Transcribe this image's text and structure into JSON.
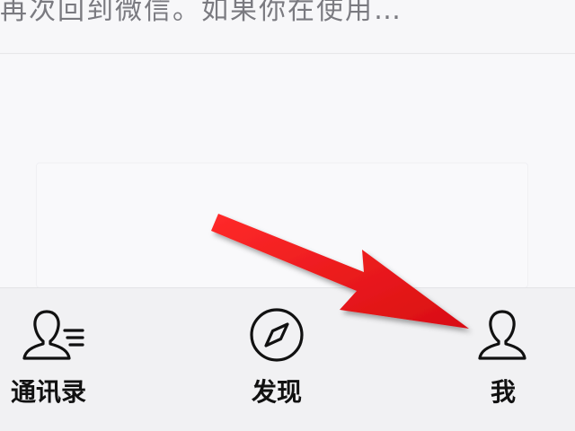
{
  "top_snippet": {
    "text": "再次回到微信。如果你在使用…"
  },
  "tabbar": {
    "tabs": [
      {
        "label": "通讯录",
        "icon": "contacts-icon"
      },
      {
        "label": "发现",
        "icon": "compass-icon"
      },
      {
        "label": "我",
        "icon": "person-icon"
      }
    ]
  },
  "colors": {
    "arrow": "#e0161a",
    "icon_stroke": "#111111",
    "tabbar_bg": "#f1f1f3",
    "page_bg": "#f6f6f8"
  }
}
